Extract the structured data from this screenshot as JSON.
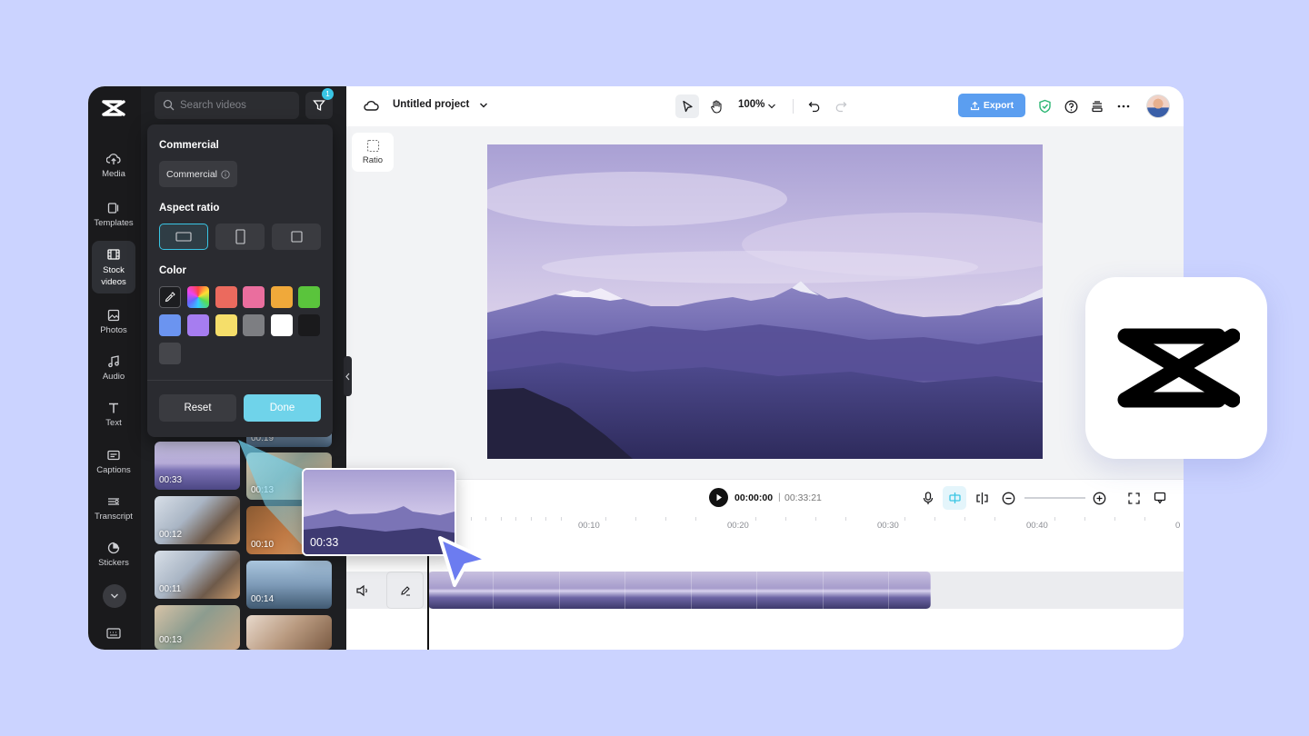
{
  "rail": {
    "logo_icon": "capcut-logo-icon",
    "items": [
      {
        "label": "Media",
        "icon": "cloud-upload-icon"
      },
      {
        "label": "Templates",
        "icon": "templates-icon"
      },
      {
        "label": "Stock videos",
        "icon": "film-icon",
        "active": true
      },
      {
        "label": "Photos",
        "icon": "image-icon"
      },
      {
        "label": "Audio",
        "icon": "music-note-icon"
      },
      {
        "label": "Text",
        "icon": "text-t-icon"
      },
      {
        "label": "Captions",
        "icon": "captions-icon"
      },
      {
        "label": "Transcript",
        "icon": "transcript-icon"
      },
      {
        "label": "Stickers",
        "icon": "sticker-icon"
      }
    ]
  },
  "panel": {
    "search_placeholder": "Search videos",
    "filter_badge": "1",
    "thumbs": [
      {
        "duration": "00:33"
      },
      {
        "duration": "00:19"
      },
      {
        "duration": "00:13"
      },
      {
        "duration": "00:12"
      },
      {
        "duration": "00:10"
      },
      {
        "duration": "00:11"
      },
      {
        "duration": "00:14"
      },
      {
        "duration": "00:13"
      }
    ]
  },
  "filter": {
    "commercial_heading": "Commercial",
    "commercial_chip": "Commercial",
    "aspect_heading": "Aspect ratio",
    "color_heading": "Color",
    "colors": [
      "#eb6a5e",
      "#ea6e9e",
      "#f0a93a",
      "#5ac43c",
      "#6b94f0",
      "#a67df0",
      "#f5de6a",
      "#7d7e82",
      "#ffffff",
      "#1a1a1c",
      "#45464b"
    ],
    "reset_label": "Reset",
    "done_label": "Done",
    "accent": "#6fd3ea"
  },
  "topbar": {
    "project_title": "Untitled project",
    "zoom": "100%",
    "export_label": "Export"
  },
  "canvas": {
    "ratio_label": "Ratio"
  },
  "playback": {
    "current_time": "00:00:00",
    "separator": "|",
    "total_time": "00:33:21"
  },
  "timeline": {
    "ruler": [
      "00:10",
      "00:20",
      "00:30",
      "00:40",
      "0"
    ]
  },
  "drag": {
    "duration": "00:33"
  }
}
